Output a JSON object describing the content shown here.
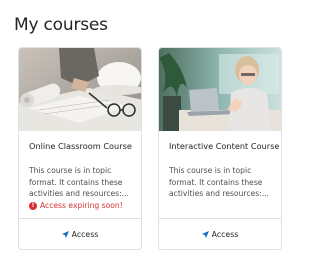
{
  "page": {
    "title": "My courses"
  },
  "courses": [
    {
      "title": "Online Classroom Course",
      "description_lines": [
        "This course is in topic",
        "format. It contains these",
        "activities and resources:..."
      ],
      "warning": "Access expiring soon!",
      "action_label": "Access",
      "image": "desk-with-hardhat-and-blueprints"
    },
    {
      "title": "Interactive Content Course",
      "description_lines": [
        "This course is in topic",
        "format. It contains these",
        "activities and resources:..."
      ],
      "action_label": "Access",
      "image": "woman-working-on-laptop"
    }
  ],
  "colors": {
    "accent": "#0f6cbf",
    "warning": "#d63031",
    "border": "#dee2e6"
  },
  "icons": {
    "warning": "exclamation-circle-icon",
    "access": "paper-plane-icon"
  }
}
